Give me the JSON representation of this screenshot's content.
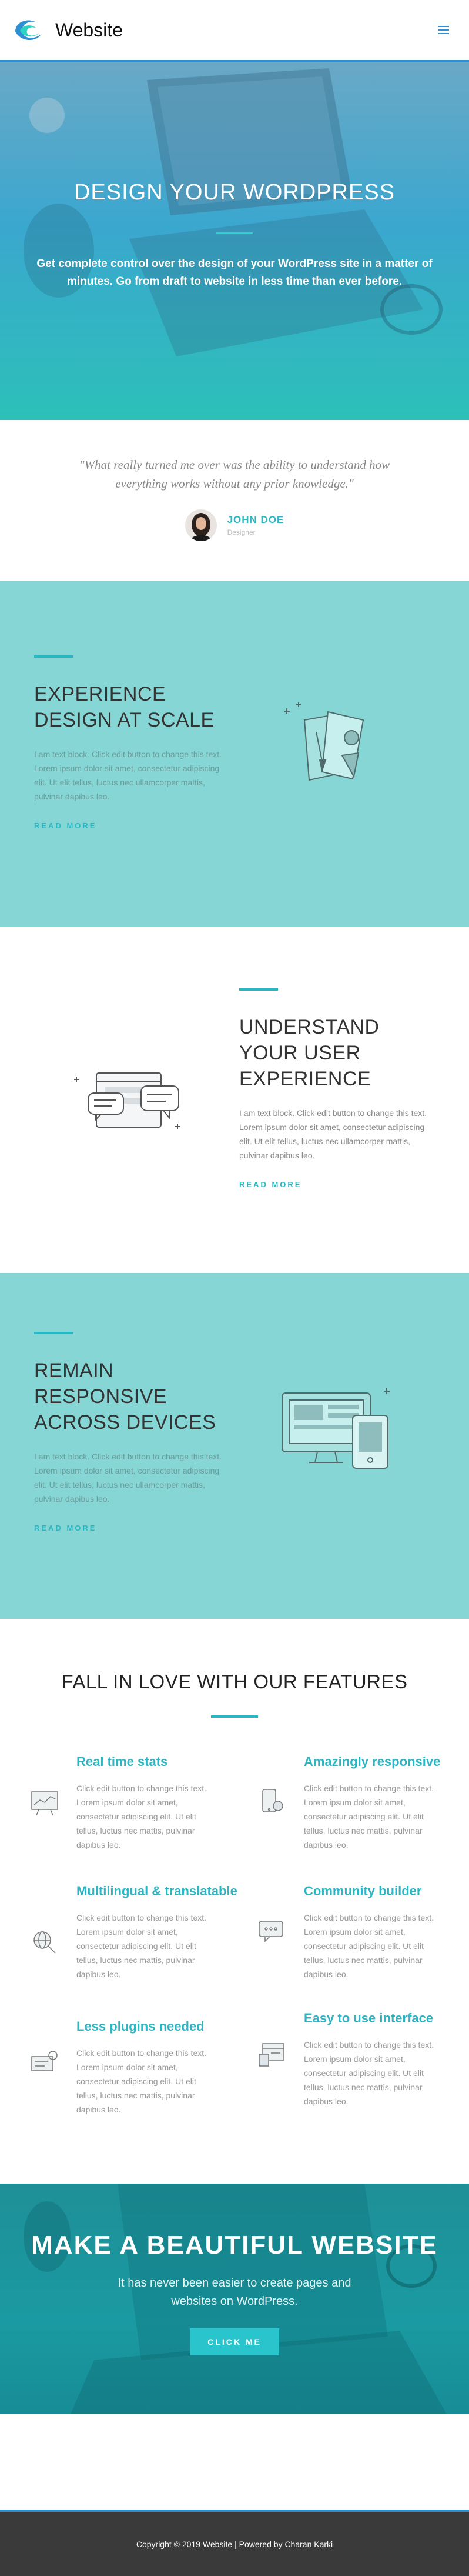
{
  "header": {
    "site_title": "Website",
    "logo_icon": "wave-logo",
    "menu_icon": "hamburger-icon",
    "accent_color": "#2f8fd3"
  },
  "hero": {
    "title": "DESIGN YOUR WORDPRESS",
    "subtitle": "Get complete control over the design of your WordPress site in a matter of minutes. Go from draft to website in less time than ever before."
  },
  "testimonial": {
    "quote": "\"What really turned me over was the ability to understand how everything works without any prior knowledge.\"",
    "name": "JOHN DOE",
    "role": "Designer"
  },
  "blocks": [
    {
      "title": "EXPERIENCE DESIGN AT SCALE",
      "desc": "I am text block. Click edit button to change this text. Lorem ipsum dolor sit amet, consectetur adipiscing elit. Ut elit tellus, luctus nec ullamcorper mattis, pulvinar dapibus leo.",
      "link": "READ MORE",
      "icon": "design-paper-brush-icon"
    },
    {
      "title": "UNDERSTAND YOUR USER EXPERIENCE",
      "desc": "I am text block. Click edit button to change this text. Lorem ipsum dolor sit amet, consectetur adipiscing elit. Ut elit tellus, luctus nec ullamcorper mattis, pulvinar dapibus leo.",
      "link": "READ MORE",
      "icon": "chat-window-icon"
    },
    {
      "title": "REMAIN RESPONSIVE ACROSS DEVICES",
      "desc": "I am text block. Click edit button to change this text. Lorem ipsum dolor sit amet, consectetur adipiscing elit. Ut elit tellus, luctus nec ullamcorper mattis, pulvinar dapibus leo.",
      "link": "READ MORE",
      "icon": "devices-icon"
    }
  ],
  "features": {
    "title": "FALL IN LOVE WITH OUR FEATURES",
    "items": [
      {
        "title": "Real time stats",
        "desc": "Click edit button to change this text. Lorem ipsum dolor sit amet, consectetur adipiscing elit. Ut elit tellus, luctus nec mattis, pulvinar dapibus leo.",
        "icon": "stats-board-icon"
      },
      {
        "title": "Amazingly responsive",
        "desc": "Click edit button to change this text. Lorem ipsum dolor sit amet, consectetur adipiscing elit. Ut elit tellus, luctus nec mattis, pulvinar dapibus leo.",
        "icon": "responsive-phone-icon"
      },
      {
        "title": "Multilingual & translatable",
        "desc": "Click edit button to change this text. Lorem ipsum dolor sit amet, consectetur adipiscing elit. Ut elit tellus, luctus nec mattis, pulvinar dapibus leo.",
        "icon": "globe-search-icon"
      },
      {
        "title": "Community builder",
        "desc": "Click edit button to change this text. Lorem ipsum dolor sit amet, consectetur adipiscing elit. Ut elit tellus, luctus nec mattis, pulvinar dapibus leo.",
        "icon": "community-chat-icon"
      },
      {
        "title": "Less plugins needed",
        "desc": "Click edit button to change this text. Lorem ipsum dolor sit amet, consectetur adipiscing elit. Ut elit tellus, luctus nec mattis, pulvinar dapibus leo.",
        "icon": "plugin-settings-icon"
      },
      {
        "title": "Easy to use interface",
        "desc": "Click edit button to change this text. Lorem ipsum dolor sit amet, consectetur adipiscing elit. Ut elit tellus, luctus nec mattis, pulvinar dapibus leo.",
        "icon": "interface-layout-icon"
      }
    ]
  },
  "cta": {
    "title": "MAKE A BEAUTIFUL WEBSITE",
    "subtitle": "It has never been easier to create pages and websites on WordPress.",
    "button": "CLICK ME"
  },
  "footer": {
    "text": "Copyright © 2019 Website | Powered by Charan Karki"
  }
}
